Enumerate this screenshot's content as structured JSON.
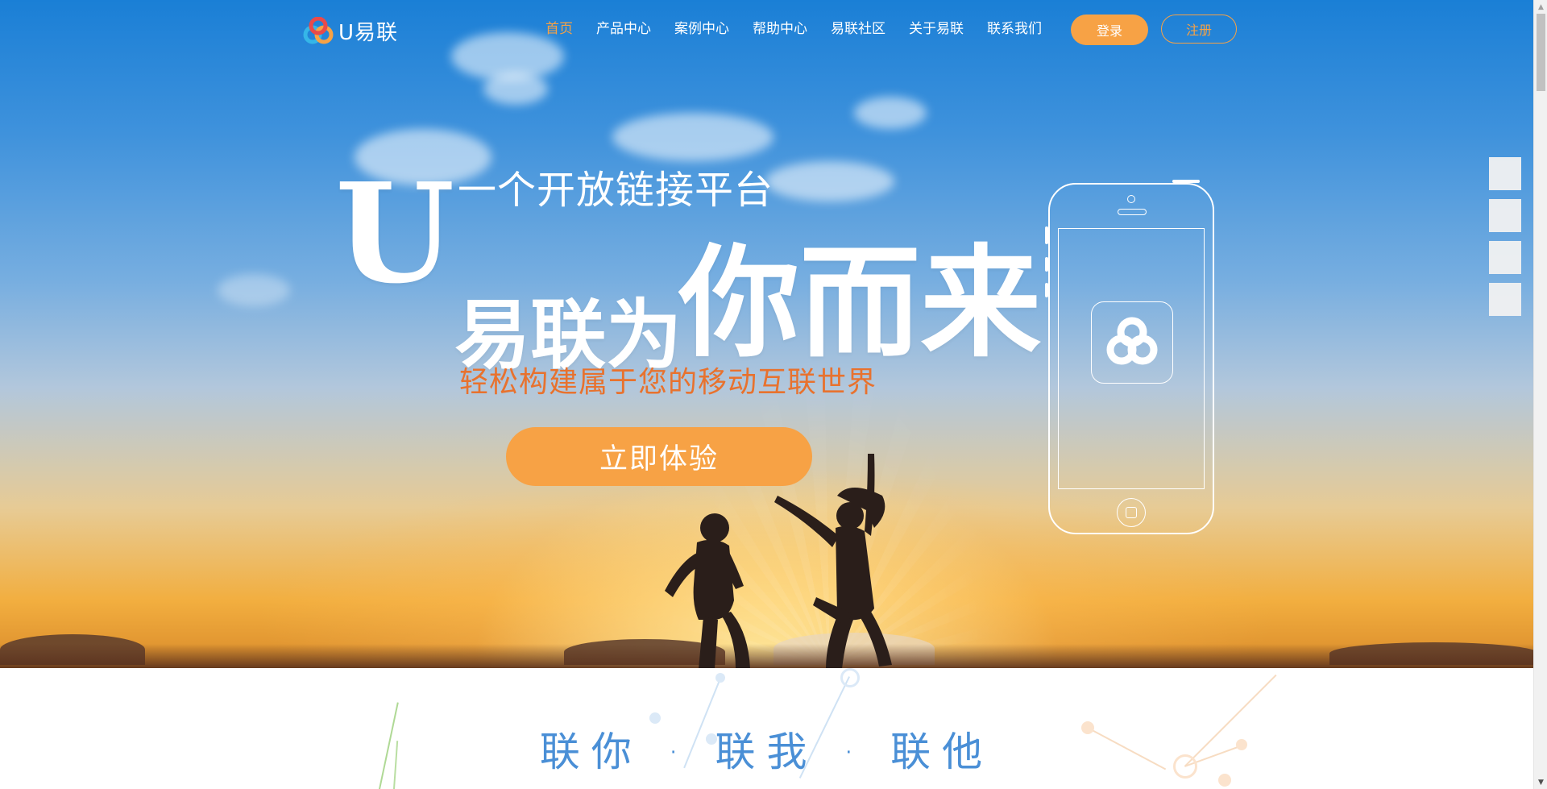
{
  "brand": {
    "logo_text": "U易联"
  },
  "nav": {
    "items": [
      {
        "label": "首页",
        "active": true
      },
      {
        "label": "产品中心",
        "active": false
      },
      {
        "label": "案例中心",
        "active": false
      },
      {
        "label": "帮助中心",
        "active": false
      },
      {
        "label": "易联社区",
        "active": false
      },
      {
        "label": "关于易联",
        "active": false
      },
      {
        "label": "联系我们",
        "active": false
      }
    ],
    "login_label": "登录",
    "register_label": "注册"
  },
  "hero": {
    "tagline": "一个开放链接平台",
    "headline_u": "U",
    "headline_rest": "易联为",
    "headline_big": "你而来",
    "subtitle": "轻松构建属于您的移动互联世界",
    "cta_label": "立即体验"
  },
  "section": {
    "title": "联你 · 联我 · 联他"
  },
  "colors": {
    "accent": "#f7a245",
    "subtitle": "#e8722e",
    "section_title": "#4a8fd6"
  },
  "icons": [
    "logo-icon",
    "phone-app-icon",
    "scroll-up-icon",
    "scroll-down-icon"
  ]
}
